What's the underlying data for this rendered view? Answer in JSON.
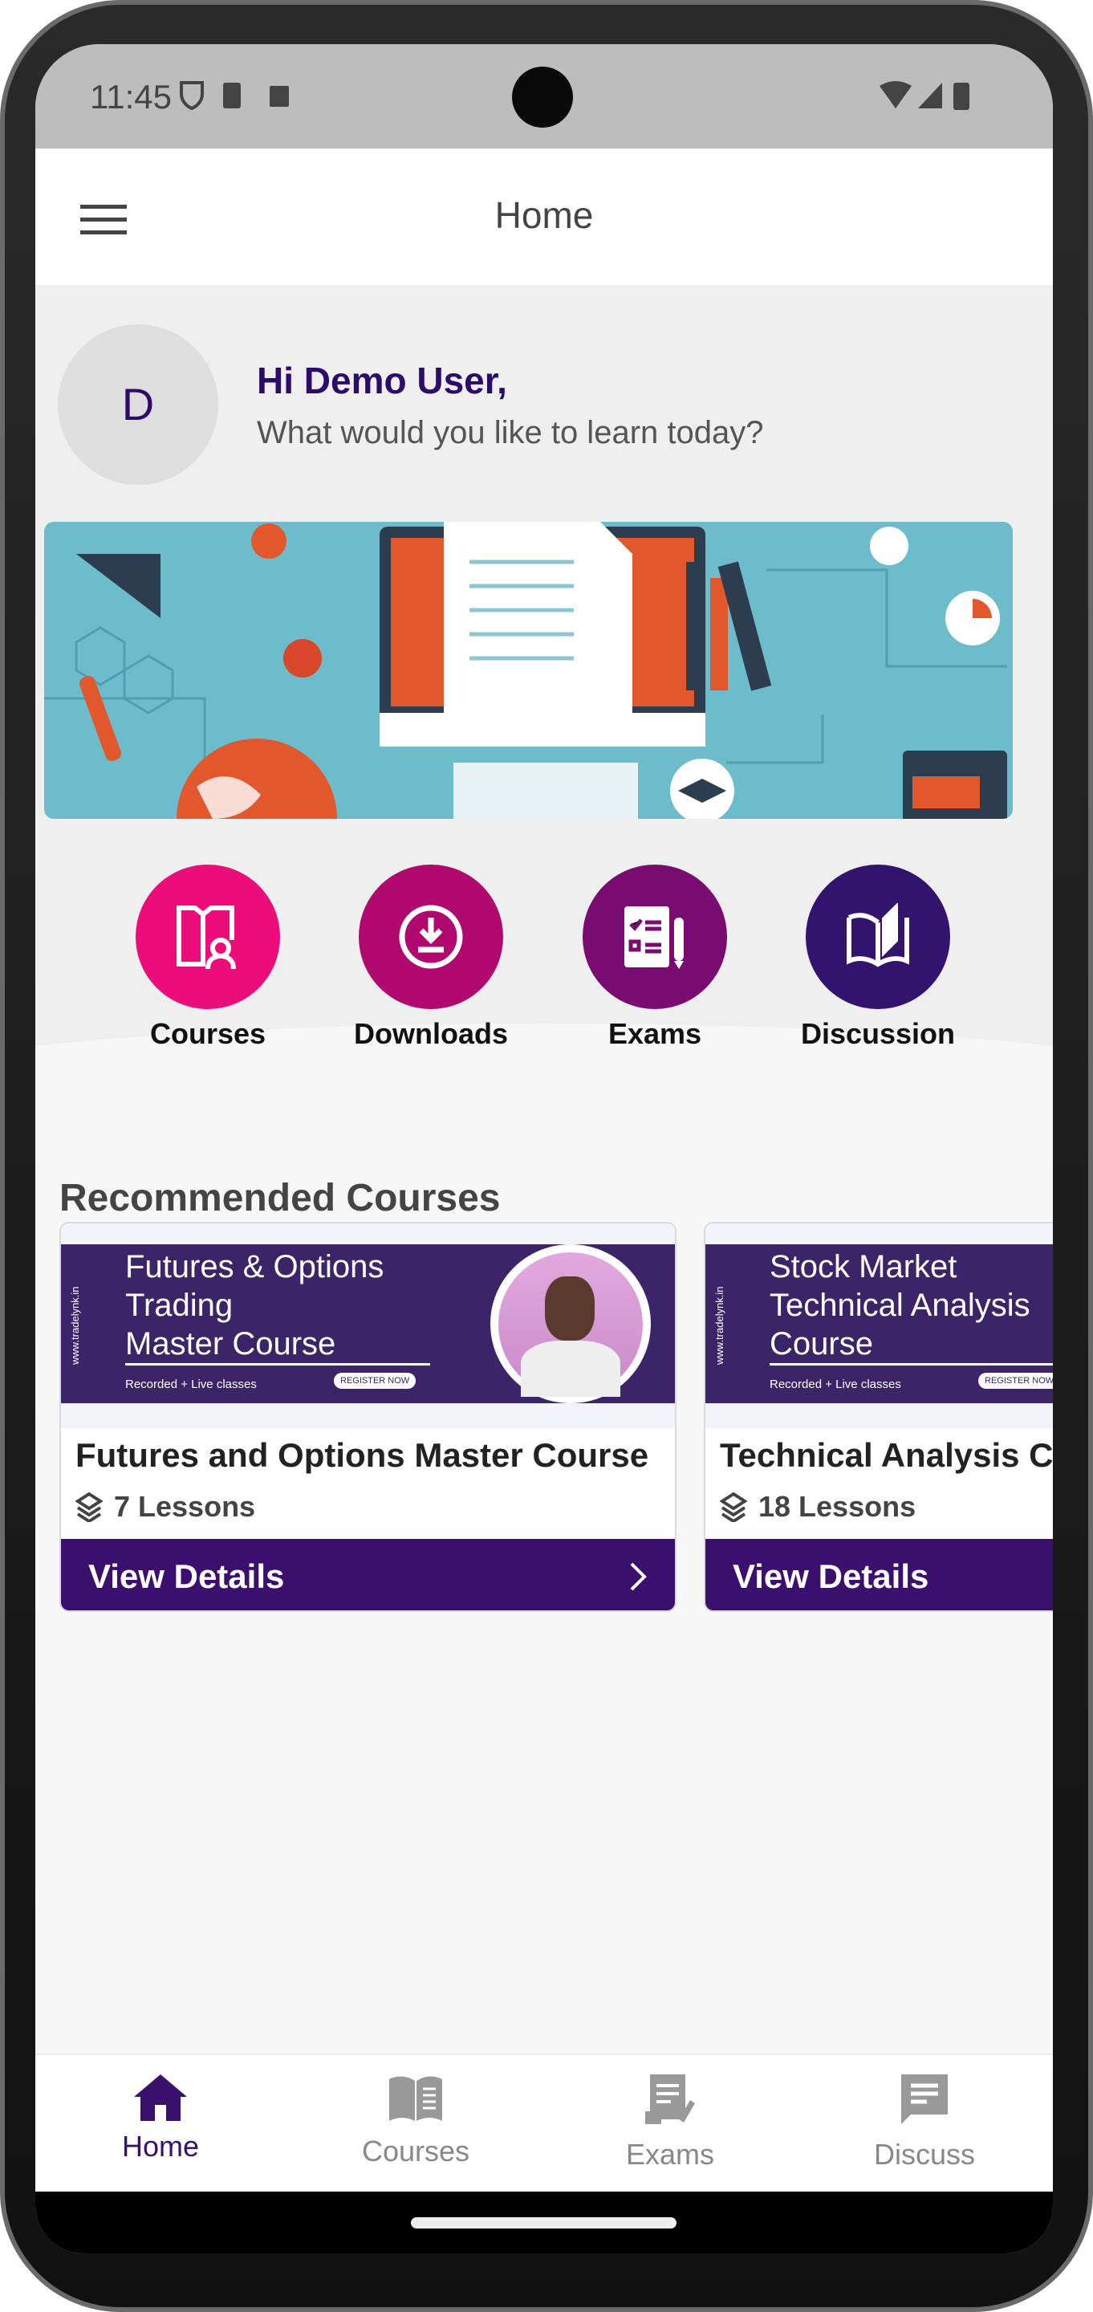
{
  "status_bar": {
    "time": "11:45"
  },
  "header": {
    "title": "Home"
  },
  "greeting": {
    "avatar_initial": "D",
    "title": "Hi Demo User,",
    "subtitle": "What would you like to learn today?"
  },
  "quick_actions": [
    {
      "label": "Courses",
      "color": "#EC0C7A",
      "icon": "book-user-icon"
    },
    {
      "label": "Downloads",
      "color": "#B0086E",
      "icon": "download-icon"
    },
    {
      "label": "Exams",
      "color": "#7A0B70",
      "icon": "checklist-icon"
    },
    {
      "label": "Discussion",
      "color": "#32136E",
      "icon": "open-book-icon"
    }
  ],
  "recommended": {
    "heading": "Recommended Courses",
    "courses": [
      {
        "banner_lines": [
          "Futures & Options",
          "Trading",
          "Master Course"
        ],
        "banner_site": "www.tradelynk.in",
        "banner_tag": "Recorded + Live classes",
        "banner_cta": "REGISTER NOW",
        "title": "Futures and Options Master Course",
        "lessons": "7 Lessons",
        "button": "View Details"
      },
      {
        "banner_lines": [
          "Stock Market",
          "Technical Analysis",
          "Course"
        ],
        "banner_site": "www.tradelynk.in",
        "banner_tag": "Recorded + Live classes",
        "banner_cta": "REGISTER NOW",
        "title": "Technical Analysis Course",
        "lessons": "18 Lessons",
        "button": "View Details"
      }
    ]
  },
  "bottom_nav": [
    {
      "label": "Home",
      "active": true
    },
    {
      "label": "Courses",
      "active": false
    },
    {
      "label": "Exams",
      "active": false
    },
    {
      "label": "Discuss",
      "active": false
    }
  ],
  "colors": {
    "primary": "#3a0f6e",
    "inactive": "#888888"
  }
}
